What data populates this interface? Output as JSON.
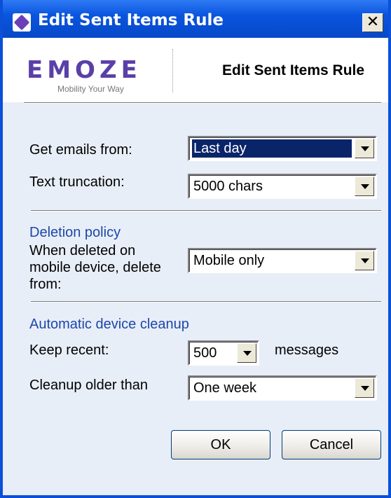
{
  "window": {
    "title": "Edit Sent Items Rule"
  },
  "header": {
    "logo_text": "EMOZE",
    "logo_tagline": "Mobility Your Way",
    "title": "Edit Sent Items Rule"
  },
  "fields": {
    "get_emails_label": "Get emails from:",
    "get_emails_value": "Last day",
    "text_truncation_label": "Text truncation:",
    "text_truncation_value": "5000 chars"
  },
  "deletion": {
    "section_title": "Deletion policy",
    "label_line1": "When deleted on",
    "label_line2": "mobile device, delete",
    "label_line3": "from:",
    "value": "Mobile only"
  },
  "cleanup": {
    "section_title": "Automatic device cleanup",
    "keep_recent_label": "Keep recent:",
    "keep_recent_value": "500",
    "keep_recent_suffix": "messages",
    "older_than_label": "Cleanup older than",
    "older_than_value": "One week"
  },
  "buttons": {
    "ok": "OK",
    "cancel": "Cancel"
  },
  "colors": {
    "titlebar": "#0a55de",
    "section_title": "#1c47a8",
    "selection": "#0a246a"
  }
}
